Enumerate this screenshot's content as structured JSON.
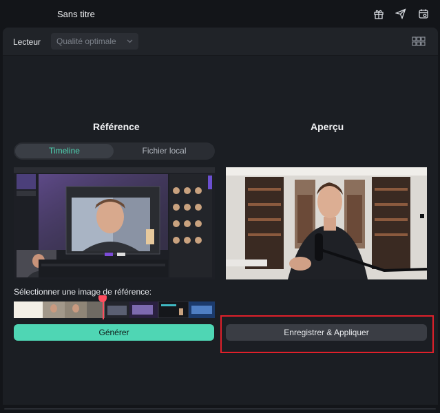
{
  "window": {
    "title": "Sans titre"
  },
  "toolbar_icons": [
    "gift-icon",
    "send-icon",
    "calendar-settings-icon"
  ],
  "player": {
    "label": "Lecteur",
    "quality": {
      "value": "Qualité optimale",
      "disabled": true
    },
    "layout_icon": "grid-layout-icon"
  },
  "reference": {
    "title": "Référence",
    "tabs": [
      {
        "label": "Timeline",
        "active": true
      },
      {
        "label": "Fichier local",
        "active": false
      }
    ],
    "select_label": "Sélectionner une image de référence:",
    "generate_label": "Générer"
  },
  "preview": {
    "title": "Aperçu",
    "save_apply_label": "Enregistrer & Appliquer"
  },
  "colors": {
    "accent": "#4fd6b4",
    "background": "#1b1e23",
    "highlight": "#e0202a",
    "playhead": "#ff4d5e"
  }
}
